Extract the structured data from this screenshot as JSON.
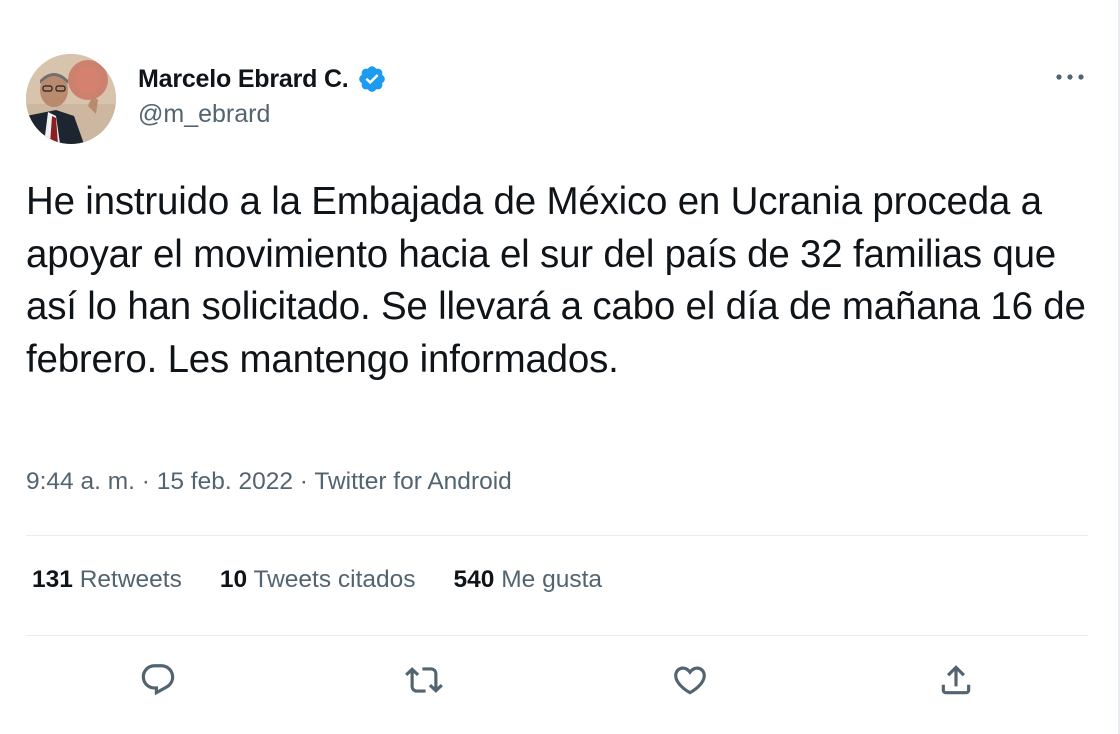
{
  "user": {
    "display_name": "Marcelo Ebrard C.",
    "handle": "@m_ebrard",
    "verified": true
  },
  "tweet": {
    "text": "He instruido a la Embajada de México en Ucrania proceda a apoyar el movimiento hacia el sur del país de 32 familias que así lo han solicitado. Se llevará a cabo el día de mañana 16 de febrero. Les mantengo informados.",
    "time": "9:44 a. m.",
    "date": "15 feb. 2022",
    "source": "Twitter for Android",
    "separator": "·"
  },
  "stats": {
    "retweets_count": "131",
    "retweets_label": "Retweets",
    "quotes_count": "10",
    "quotes_label": "Tweets citados",
    "likes_count": "540",
    "likes_label": "Me gusta"
  },
  "icons": {
    "more": "more-icon",
    "reply": "reply-icon",
    "retweet": "retweet-icon",
    "like": "like-icon",
    "share": "share-icon",
    "verified": "verified-badge-icon"
  },
  "colors": {
    "text": "#0f1419",
    "secondary": "#536471",
    "verified": "#1d9bf0",
    "divider": "#e6ecf0"
  }
}
